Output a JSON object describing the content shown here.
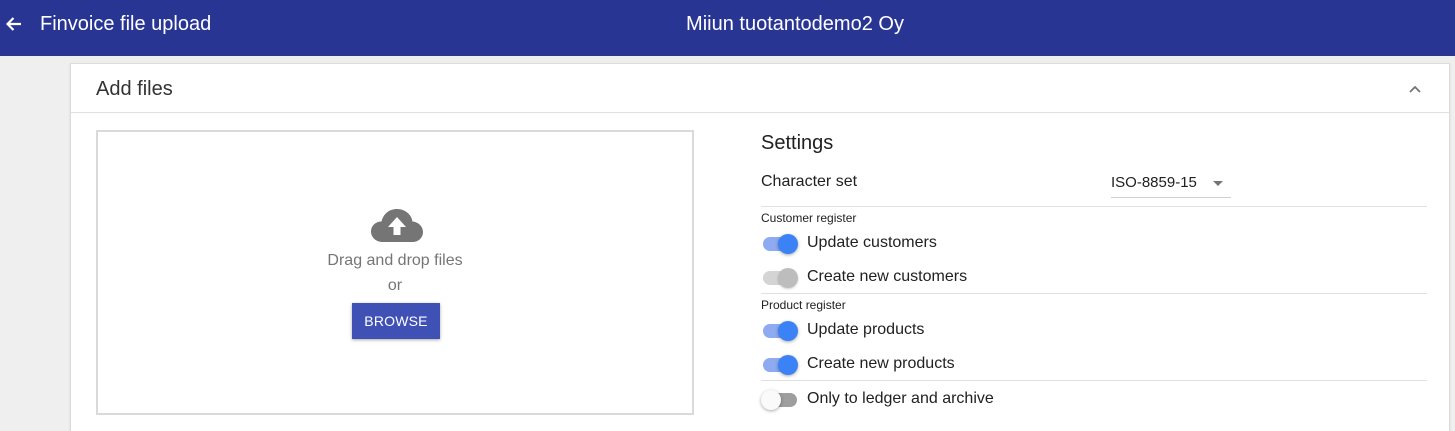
{
  "header": {
    "title": "Finvoice file upload",
    "company": "Miiun tuotantodemo2 Oy",
    "color": "#283593"
  },
  "card": {
    "title": "Add files"
  },
  "dropzone": {
    "drag_text": "Drag and drop files",
    "or_text": "or",
    "browse_label": "BROWSE",
    "icon": "cloud-upload-icon"
  },
  "settings": {
    "title": "Settings",
    "charset_label": "Character set",
    "charset_value": "ISO-8859-15",
    "customer_register": {
      "label": "Customer register",
      "update_customers": {
        "label": "Update customers",
        "on": true
      },
      "create_customers": {
        "label": "Create new customers",
        "on": true,
        "disabled": true
      }
    },
    "product_register": {
      "label": "Product register",
      "update_products": {
        "label": "Update products",
        "on": true
      },
      "create_products": {
        "label": "Create new products",
        "on": true
      }
    },
    "ledger_only": {
      "label": "Only to ledger and archive",
      "on": false
    }
  },
  "colors": {
    "accent": "#3f51b5",
    "toggle_on": "#3b82f6"
  }
}
